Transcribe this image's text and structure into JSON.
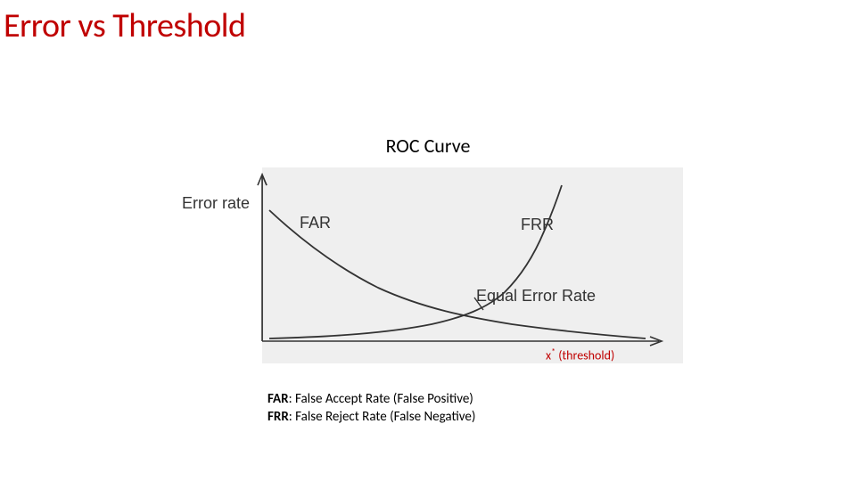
{
  "title": "Error vs Threshold",
  "chart_title": "ROC Curve",
  "axes": {
    "y_label": "Error rate",
    "x_label_prefix": "x",
    "x_label_super": "*",
    "x_label_suffix": " (threshold)"
  },
  "curve_labels": {
    "far": "FAR",
    "frr": "FRR",
    "eer": "Equal Error Rate"
  },
  "legend": {
    "far_bold": "FAR",
    "far_rest": ": False Accept Rate (False Positive)",
    "frr_bold": "FRR",
    "frr_rest": ": False Reject Rate (False Negative)"
  },
  "chart_data": {
    "type": "line",
    "title": "ROC Curve",
    "xlabel": "x* (threshold)",
    "ylabel": "Error rate",
    "xlim": [
      0,
      1
    ],
    "ylim": [
      0,
      1
    ],
    "equal_error_rate": {
      "x": 0.56,
      "y": 0.18
    },
    "series": [
      {
        "name": "FAR",
        "x": [
          0.0,
          0.1,
          0.2,
          0.3,
          0.4,
          0.5,
          0.6,
          0.7,
          0.8,
          0.9,
          1.0
        ],
        "values": [
          0.8,
          0.58,
          0.44,
          0.34,
          0.26,
          0.2,
          0.15,
          0.1,
          0.05,
          0.02,
          0.0
        ]
      },
      {
        "name": "FRR",
        "x": [
          0.0,
          0.1,
          0.2,
          0.3,
          0.4,
          0.5,
          0.6,
          0.7,
          0.8,
          0.9,
          1.0
        ],
        "values": [
          0.0,
          0.01,
          0.03,
          0.05,
          0.08,
          0.12,
          0.2,
          0.33,
          0.5,
          0.72,
          1.0
        ]
      }
    ]
  }
}
